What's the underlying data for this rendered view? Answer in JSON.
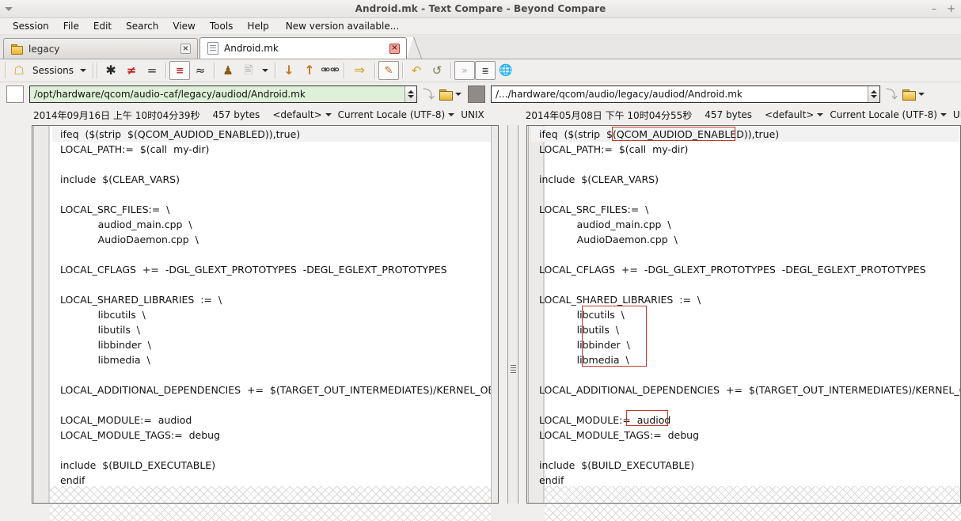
{
  "window": {
    "title": "Android.mk - Text Compare - Beyond Compare",
    "minimize_label": "–",
    "maximize_label": "+"
  },
  "menu": {
    "items": [
      {
        "label": "Session",
        "name": "menu-session"
      },
      {
        "label": "File",
        "name": "menu-file"
      },
      {
        "label": "Edit",
        "name": "menu-edit"
      },
      {
        "label": "Search",
        "name": "menu-search"
      },
      {
        "label": "View",
        "name": "menu-view"
      },
      {
        "label": "Tools",
        "name": "menu-tools"
      },
      {
        "label": "Help",
        "name": "menu-help"
      },
      {
        "label": "New version available...",
        "name": "menu-new-version"
      }
    ]
  },
  "tabs": [
    {
      "label": "legacy",
      "icon": "folder-icon",
      "active": false,
      "close": "×"
    },
    {
      "label": "Android.mk",
      "icon": "document-icon",
      "active": true,
      "close": "×"
    }
  ],
  "toolbar": {
    "sessions_label": "Sessions",
    "buttons": [
      {
        "name": "session-home-button",
        "glyph": "⌂"
      },
      {
        "name": "show-all-button",
        "glyph": "∗"
      },
      {
        "name": "show-differences-button",
        "glyph": "≠"
      },
      {
        "name": "show-same-button",
        "glyph": "="
      },
      {
        "name": "show-minor-differences-button",
        "glyph": "⩲"
      },
      {
        "name": "ignore-unimportant-button",
        "glyph": "≈"
      },
      {
        "name": "rules-button",
        "glyph": "♟"
      },
      {
        "name": "session-settings-button",
        "glyph": "☷"
      },
      {
        "name": "next-difference-button",
        "glyph": "↓"
      },
      {
        "name": "previous-difference-button",
        "glyph": "↑"
      },
      {
        "name": "find-button",
        "glyph": "⚲"
      },
      {
        "name": "copy-to-right-button",
        "glyph": "⇒"
      },
      {
        "name": "edit-button",
        "glyph": "✐"
      },
      {
        "name": "undo-button",
        "glyph": "↶"
      },
      {
        "name": "refresh-button",
        "glyph": "↻"
      },
      {
        "name": "next-section-button",
        "glyph": "»"
      },
      {
        "name": "line-numbers-button",
        "glyph": "☰"
      },
      {
        "name": "web-button",
        "glyph": "◔"
      }
    ]
  },
  "left_file": {
    "path": "/opt/hardware/qcom/audio-caf/legacy/audiod/Android.mk",
    "timestamp": "2014年09月16日 上午 10时04分39秒",
    "size": "457 bytes",
    "format": "<default>",
    "encoding": "Current Locale (UTF-8)",
    "line_ending": "UNIX",
    "lines": [
      "ifeq  ($(strip  $(QCOM_AUDIOD_ENABLED)),true)",
      "LOCAL_PATH:=  $(call  my-dir)",
      "",
      "include  $(CLEAR_VARS)",
      "",
      "LOCAL_SRC_FILES:=  \\",
      "            audiod_main.cpp  \\",
      "            AudioDaemon.cpp  \\",
      "",
      "LOCAL_CFLAGS  +=  -DGL_GLEXT_PROTOTYPES  -DEGL_EGLEXT_PROTOTYPES",
      "",
      "LOCAL_SHARED_LIBRARIES  :=  \\",
      "            libcutils  \\",
      "            libutils  \\",
      "            libbinder  \\",
      "            libmedia  \\",
      "",
      "LOCAL_ADDITIONAL_DEPENDENCIES  +=  $(TARGET_OUT_INTERMEDIATES)/KERNEL_OBJ/usr",
      "",
      "LOCAL_MODULE:=  audiod",
      "LOCAL_MODULE_TAGS:=  debug",
      "",
      "include  $(BUILD_EXECUTABLE)",
      "endif"
    ]
  },
  "right_file": {
    "path": "/.../hardware/qcom/audio/legacy/audiod/Android.mk",
    "timestamp": "2014年05月08日 下午 10时04分55秒",
    "size": "457 bytes",
    "format": "<default>",
    "encoding": "Current Locale (UTF-8)",
    "line_ending": "UNIX",
    "lines": [
      "ifeq  ($(strip  $(QCOM_AUDIOD_ENABLED)),true)",
      "LOCAL_PATH:=  $(call  my-dir)",
      "",
      "include  $(CLEAR_VARS)",
      "",
      "LOCAL_SRC_FILES:=  \\",
      "            audiod_main.cpp  \\",
      "            AudioDaemon.cpp  \\",
      "",
      "LOCAL_CFLAGS  +=  -DGL_GLEXT_PROTOTYPES  -DEGL_EGLEXT_PROTOTYPES",
      "",
      "LOCAL_SHARED_LIBRARIES  :=  \\",
      "            libcutils  \\",
      "            libutils  \\",
      "            libbinder  \\",
      "            libmedia  \\",
      "",
      "LOCAL_ADDITIONAL_DEPENDENCIES  +=  $(TARGET_OUT_INTERMEDIATES)/KERNEL_OBJ/u",
      "",
      "LOCAL_MODULE:=  audiod",
      "LOCAL_MODULE_TAGS:=  debug",
      "",
      "include  $(BUILD_EXECUTABLE)",
      "endif"
    ]
  },
  "annotations": {
    "accent_color": "#c0392b",
    "boxes": [
      {
        "name": "annotation-box-qcom-audiod-enabled",
        "target": "QCOM_AUDIOD_ENABLED"
      },
      {
        "name": "annotation-box-shared-libraries",
        "target": "libcutils libutils libbinder libmedia"
      },
      {
        "name": "annotation-box-local-module",
        "target": "audiod"
      }
    ]
  }
}
